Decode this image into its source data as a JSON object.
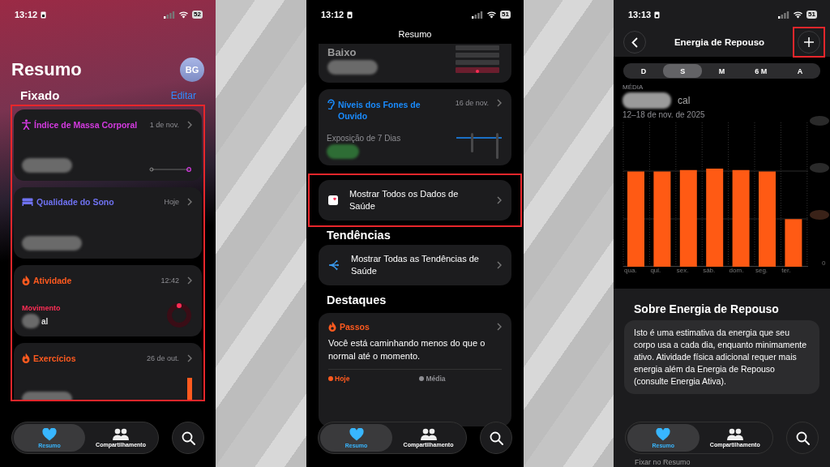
{
  "summary_screen": {
    "status_bar": {
      "time": "13:12",
      "battery": "52"
    },
    "title": "Resumo",
    "avatar": "BG",
    "section": "Fixado",
    "edit_link": "Editar",
    "pinned_highlighted": true,
    "pinned_cards": [
      {
        "kind": "line",
        "title": "Índice de Massa Corporal",
        "date": "1 de nov.",
        "color": "#d43ae0"
      },
      {
        "kind": "plain",
        "title": "Qualidade do Sono",
        "date": "Hoje",
        "color": "#6f72f2"
      },
      {
        "kind": "ring",
        "title": "Atividade",
        "date": "12:42",
        "color": "#ff5a1f",
        "metric": "Movimento",
        "unit": "al"
      },
      {
        "kind": "bar",
        "title": "Exercícios",
        "date": "26 de out.",
        "color": "#ff5a1f"
      }
    ],
    "tab_bar": [
      {
        "label": "Resumo",
        "selected": true
      },
      {
        "label": "Compartilhamento",
        "selected": false
      }
    ]
  },
  "scrolled_screen": {
    "status_bar": {
      "time": "13:12",
      "battery": "51"
    },
    "nav_title": "Resumo",
    "top_card_value": "Baixo",
    "headphone_card": {
      "title": "Níveis dos Fones de Ouvido",
      "date": "16 de nov.",
      "subtitle": "Exposição de 7 Dias"
    },
    "all_data_link": {
      "label": "Mostrar Todos os Dados de Saúde",
      "highlighted": true
    },
    "trends_heading": "Tendências",
    "trends_link": {
      "label": "Mostrar Todas as Tendências de Saúde"
    },
    "highlights_heading": "Destaques",
    "highlight_card": {
      "title": "Passos",
      "text": "Você está caminhando menos do que o normal até o momento.",
      "legend": [
        {
          "label": "Hoje",
          "color": "#ff5a1f"
        },
        {
          "label": "Média",
          "color": "#8e8e93"
        }
      ]
    },
    "tab_bar": [
      {
        "label": "Resumo",
        "selected": true
      },
      {
        "label": "Compartilhamento",
        "selected": false
      }
    ]
  },
  "detail_screen": {
    "status_bar": {
      "time": "13:13",
      "battery": "51"
    },
    "title": "Energia de Repouso",
    "add_highlighted": true,
    "segments": [
      {
        "label": "D",
        "selected": false
      },
      {
        "label": "S",
        "selected": true
      },
      {
        "label": "M",
        "selected": false
      },
      {
        "label": "6 M",
        "selected": false
      },
      {
        "label": "A",
        "selected": false
      }
    ],
    "average_label": "MÉDIA",
    "unit": "cal",
    "date_range": "12–18 de nov. de 2025",
    "chart_days": [
      "qua.",
      "qui.",
      "sex.",
      "sáb.",
      "dom.",
      "seg.",
      "ter."
    ],
    "y_tick": "0",
    "about_title": "Sobre Energia de Repouso",
    "about_text": "Isto é uma estimativa da energia que seu corpo usa a cada dia, enquanto minimamente ativo. Atividade física adicional requer mais energia além da Energia de Repouso (consulte Energia Ativa).",
    "tab_bar": [
      {
        "label": "Resumo",
        "selected": true
      },
      {
        "label": "Compartilhamento",
        "selected": false
      }
    ],
    "pin_label": "Fixar no Resumo"
  }
}
